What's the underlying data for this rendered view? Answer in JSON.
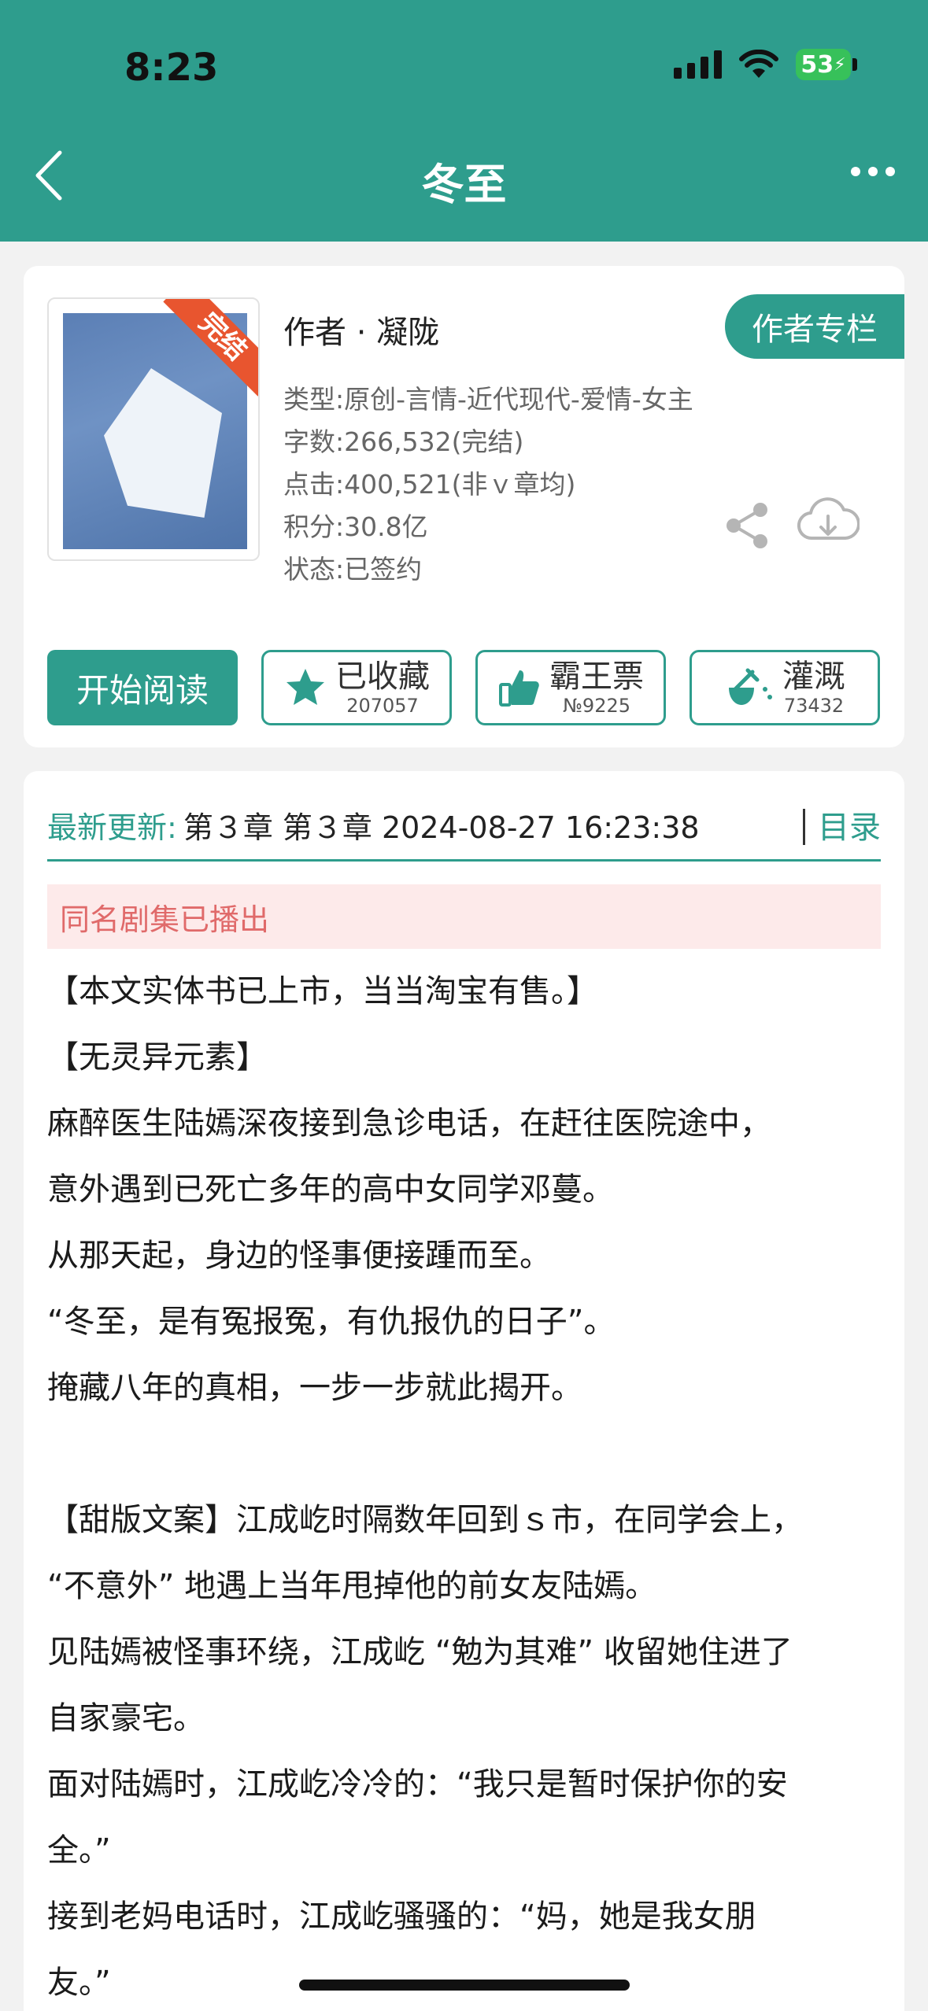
{
  "status_bar": {
    "time": "8:23",
    "battery": "53"
  },
  "nav": {
    "title": "冬至"
  },
  "book": {
    "cover_badge": "完结",
    "author_line": "作者 · 凝陇",
    "author_column_button": "作者专栏",
    "meta": [
      "类型:原创-言情-近代现代-爱情-女主",
      "字数:266,532(完结)",
      "点击:400,521(非ｖ章均)",
      "积分:30.8亿",
      "状态:已签约"
    ]
  },
  "actions": {
    "read": "开始阅读",
    "favorite": {
      "label": "已收藏",
      "count": "207057"
    },
    "ticket": {
      "label": "霸王票",
      "count": "№9225"
    },
    "water": {
      "label": "灌溉",
      "count": "73432"
    }
  },
  "update": {
    "label": "最新更新:",
    "text": "第３章 第３章 2024-08-27 16:23:38",
    "toc": "目录"
  },
  "notice": "同名剧集已播出",
  "description": [
    "【本文实体书已上市，当当淘宝有售。】",
    "【无灵异元素】",
    "麻醉医生陆嫣深夜接到急诊电话，在赶往医院途中，",
    "意外遇到已死亡多年的高中女同学邓蔓。",
    "从那天起，身边的怪事便接踵而至。",
    "“冬至，是有冤报冤，有仇报仇的日子”。",
    "掩藏八年的真相，一步一步就此揭开。",
    "",
    "【甜版文案】江成屹时隔数年回到ｓ市，在同学会上，",
    "“不意外” 地遇上当年甩掉他的前女友陆嫣。",
    "见陆嫣被怪事环绕，江成屹 “勉为其难” 收留她住进了",
    "自家豪宅。",
    "面对陆嫣时，江成屹冷冷的：“我只是暂时保护你的安",
    "全。”",
    "接到老妈电话时，江成屹骚骚的：“妈，她是我女朋",
    "友。”"
  ]
}
